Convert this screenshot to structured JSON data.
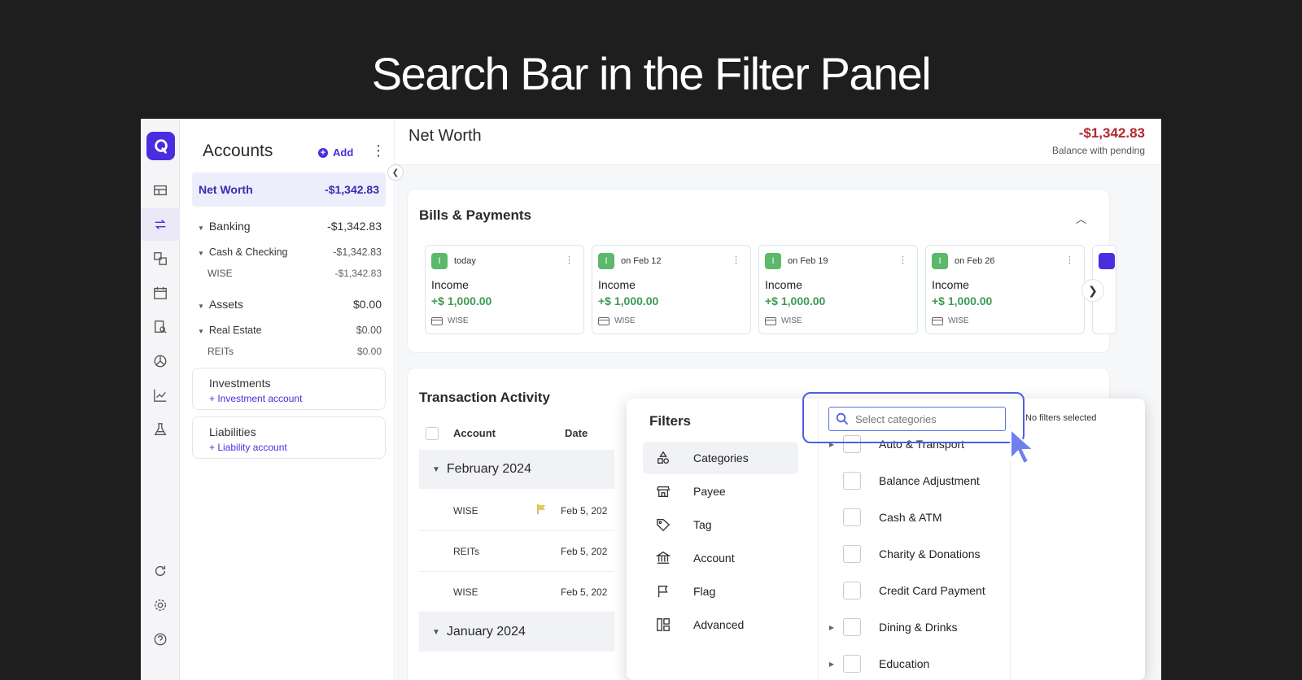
{
  "headline": "Search Bar in the Filter Panel",
  "colors": {
    "brand": "#4b2de0",
    "negative": "#b3262e",
    "positive": "#3c9a52"
  },
  "rail": {
    "icons": [
      "dashboard-icon",
      "transactions-icon",
      "accounts-icon",
      "calendar-icon",
      "reports-search-icon",
      "budget-pie-icon",
      "investments-chart-icon",
      "lab-flask-icon",
      "refresh-icon",
      "settings-icon",
      "help-icon"
    ]
  },
  "sidebar": {
    "title": "Accounts",
    "add_label": "Add",
    "net_worth": {
      "label": "Net Worth",
      "value": "-$1,342.83"
    },
    "rows": [
      {
        "label": "Banking",
        "value": "-$1,342.83"
      },
      {
        "label": "Cash & Checking",
        "value": "-$1,342.83"
      },
      {
        "label": "WISE",
        "value": "-$1,342.83"
      },
      {
        "label": "Assets",
        "value": "$0.00"
      },
      {
        "label": "Real Estate",
        "value": "$0.00"
      },
      {
        "label": "REITs",
        "value": "$0.00"
      }
    ],
    "investments": {
      "title": "Investments",
      "link": "+ Investment account"
    },
    "liabilities": {
      "title": "Liabilities",
      "link": "+ Liability account"
    }
  },
  "main": {
    "title": "Net Worth",
    "balance": "-$1,342.83",
    "balance_label": "Balance with pending"
  },
  "bills": {
    "title": "Bills & Payments",
    "items": [
      {
        "badge": "I",
        "when": "today",
        "name": "Income",
        "amount": "+$ 1,000.00",
        "account": "WISE"
      },
      {
        "badge": "I",
        "when": "on Feb 12",
        "name": "Income",
        "amount": "+$ 1,000.00",
        "account": "WISE"
      },
      {
        "badge": "I",
        "when": "on Feb 19",
        "name": "Income",
        "amount": "+$ 1,000.00",
        "account": "WISE"
      },
      {
        "badge": "I",
        "when": "on Feb 26",
        "name": "Income",
        "amount": "+$ 1,000.00",
        "account": "WISE"
      }
    ]
  },
  "transactions": {
    "title": "Transaction Activity",
    "columns": [
      "Account",
      "Date"
    ],
    "groups": [
      {
        "month": "February 2024",
        "rows": [
          {
            "account": "WISE",
            "date": "Feb 5, 202"
          },
          {
            "account": "REITs",
            "date": "Feb 5, 202"
          },
          {
            "account": "WISE",
            "date": "Feb 5, 202"
          }
        ]
      },
      {
        "month": "January 2024"
      }
    ]
  },
  "filters": {
    "title": "Filters",
    "menu": [
      {
        "label": "Categories",
        "icon": "categories-shapes-icon"
      },
      {
        "label": "Payee",
        "icon": "store-icon"
      },
      {
        "label": "Tag",
        "icon": "tag-icon"
      },
      {
        "label": "Account",
        "icon": "bank-icon"
      },
      {
        "label": "Flag",
        "icon": "flag-icon"
      },
      {
        "label": "Advanced",
        "icon": "advanced-layout-icon"
      }
    ],
    "search_placeholder": "Select categories",
    "no_filters": "No filters selected",
    "categories": [
      {
        "label": "Auto & Transport",
        "expandable": true
      },
      {
        "label": "Balance Adjustment",
        "expandable": false
      },
      {
        "label": "Cash & ATM",
        "expandable": false
      },
      {
        "label": "Charity & Donations",
        "expandable": false
      },
      {
        "label": "Credit Card Payment",
        "expandable": false
      },
      {
        "label": "Dining & Drinks",
        "expandable": true
      },
      {
        "label": "Education",
        "expandable": true
      }
    ]
  }
}
